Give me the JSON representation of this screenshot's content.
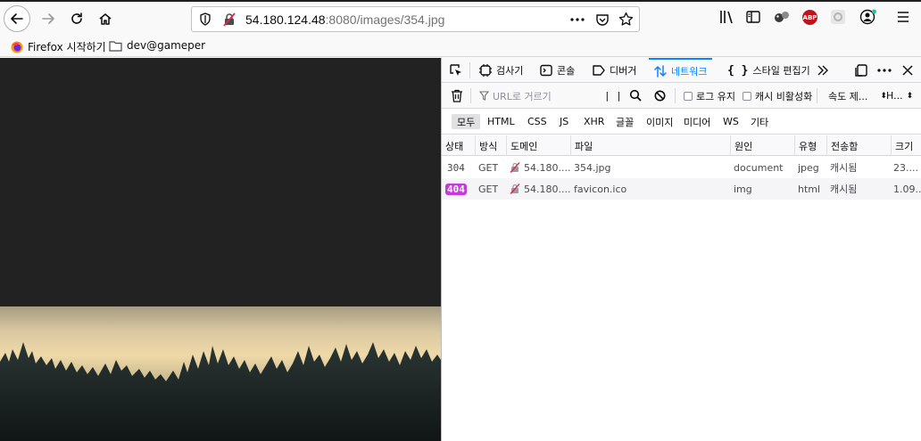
{
  "browser": {
    "url_host": "54.180.124.48",
    "url_rest": ":8080/images/354.jpg",
    "bookmarks": [
      {
        "label": "Firefox 시작하기"
      },
      {
        "label": "dev@gameper"
      }
    ],
    "icons": {
      "back": "back-arrow-icon",
      "forward": "forward-arrow-icon",
      "reload": "reload-icon",
      "home": "home-icon",
      "abp_label": "ABP"
    }
  },
  "devtools": {
    "tabs": [
      {
        "label": "검사기"
      },
      {
        "label": "콘솔"
      },
      {
        "label": "디버거"
      },
      {
        "label": "네트워크",
        "active": true
      },
      {
        "label": "스타일 편집기"
      }
    ],
    "filter": {
      "placeholder": "URL로 거르기",
      "persist_logs": "로그 유지",
      "disable_cache": "캐시 비활성화",
      "throttling": "속도 제...",
      "har": "H..."
    },
    "types": [
      "모두",
      "HTML",
      "CSS",
      "JS",
      "XHR",
      "글꼴",
      "이미지",
      "미디어",
      "WS",
      "기타"
    ],
    "columns": [
      "상태",
      "방식",
      "도메인",
      "파일",
      "원인",
      "유형",
      "전송함",
      "크기"
    ],
    "rows": [
      {
        "status": "304",
        "method": "GET",
        "domain": "54.180....",
        "file": "354.jpg",
        "cause": "document",
        "type": "jpeg",
        "transferred": "캐시됨",
        "size": "23...."
      },
      {
        "status": "404",
        "method": "GET",
        "domain": "54.180....",
        "file": "favicon.ico",
        "cause": "img",
        "type": "html",
        "transferred": "캐시됨",
        "size": "1.09..."
      }
    ]
  },
  "colors": {
    "accent": "#0a84ff",
    "status_404_bg": "#c33cda",
    "page_bg": "#222222"
  }
}
